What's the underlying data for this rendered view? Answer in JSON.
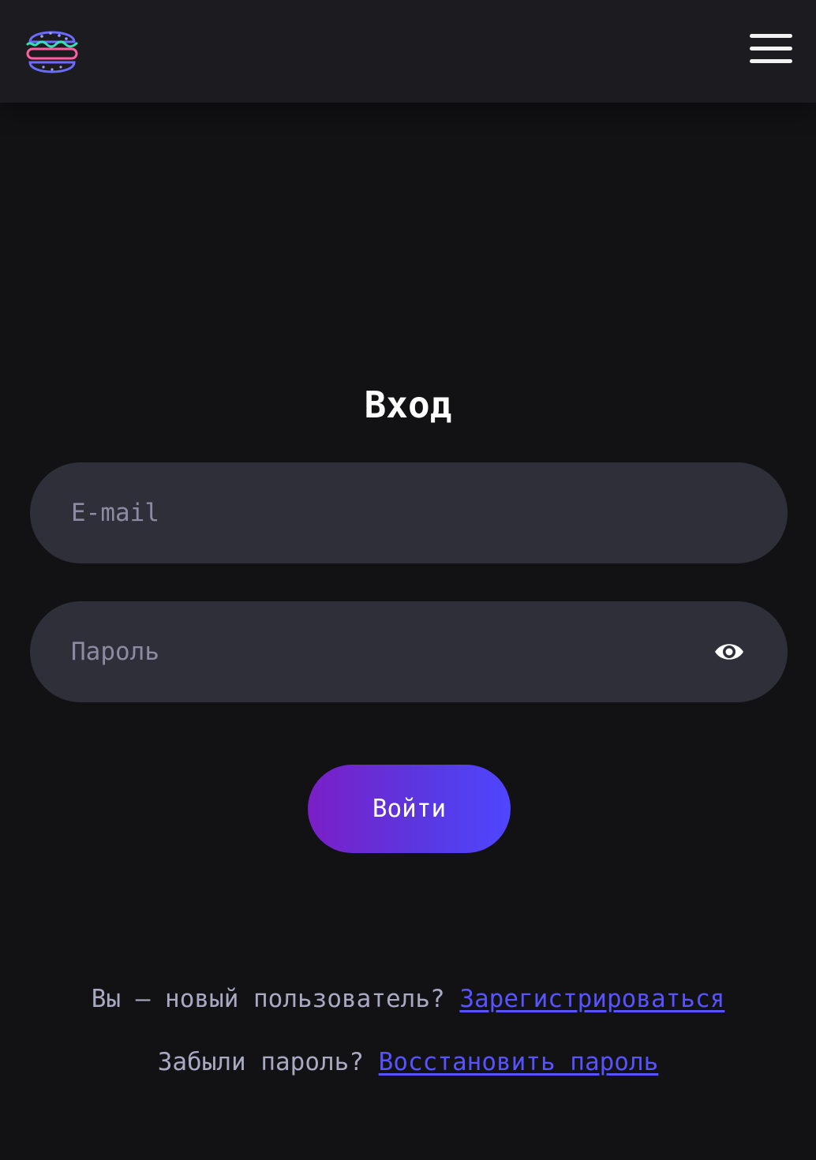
{
  "header": {
    "logo_icon": "neon-burger-icon",
    "menu_icon": "hamburger-menu-icon"
  },
  "login": {
    "title": "Вход",
    "email_placeholder": "E-mail",
    "email_value": "",
    "password_placeholder": "Пароль",
    "password_value": "",
    "password_toggle_icon": "eye-icon",
    "submit_label": "Войти"
  },
  "footer_links": {
    "register_prompt": "Вы — новый пользователь?",
    "register_link": "Зарегистрироваться",
    "forgot_prompt": "Забыли пароль?",
    "forgot_link": "Восстановить пароль"
  },
  "colors": {
    "background": "#121215",
    "header": "#1c1b20",
    "field": "#2f2f3a",
    "link": "#5653ff",
    "button_gradient_start": "#7b1fc7",
    "button_gradient_end": "#4f46ff"
  }
}
